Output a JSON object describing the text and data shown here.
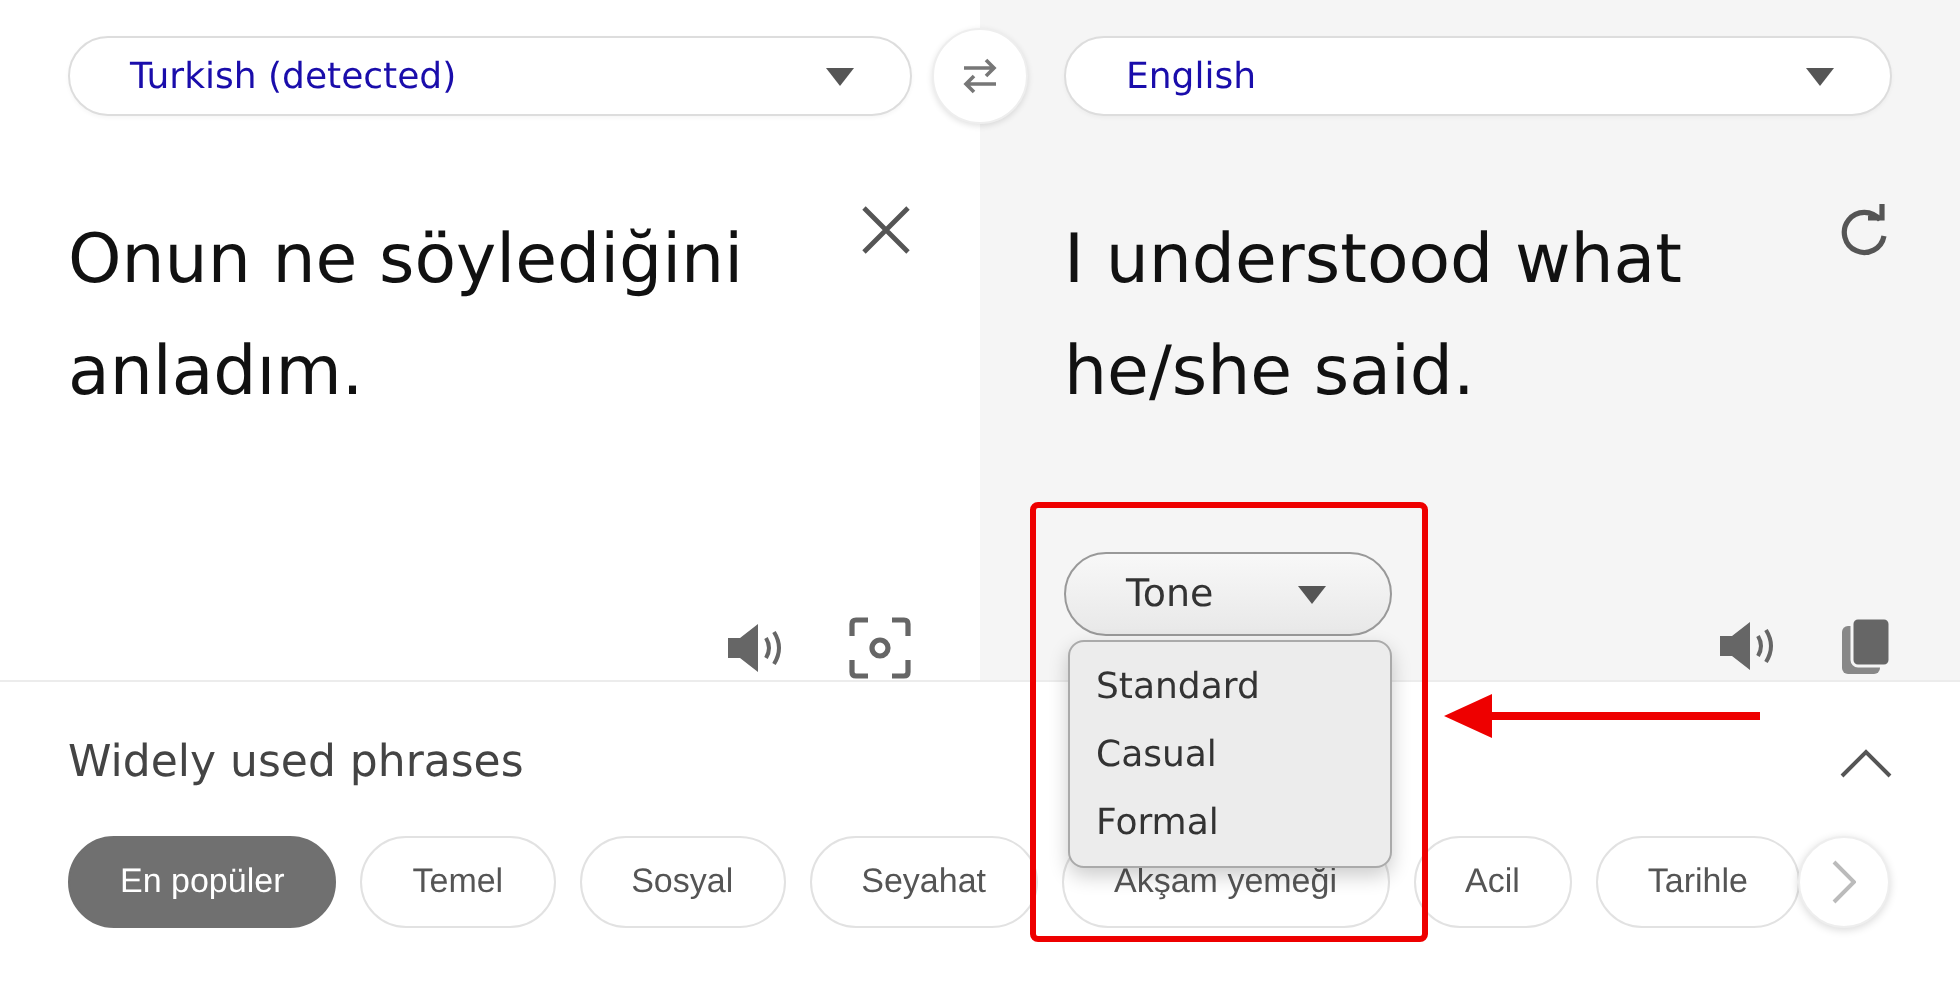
{
  "source": {
    "language": "Turkish (detected)",
    "text": "Onun ne söylediğini anladım."
  },
  "target": {
    "language": "English",
    "text": "I understood what he/she said."
  },
  "tone": {
    "label": "Tone",
    "expanded": true,
    "options": [
      "Standard",
      "Casual",
      "Formal"
    ]
  },
  "phrases": {
    "title": "Widely used phrases",
    "expanded": true,
    "categories": [
      {
        "label": "En popüler",
        "selected": true
      },
      {
        "label": "Temel",
        "selected": false
      },
      {
        "label": "Sosyal",
        "selected": false
      },
      {
        "label": "Seyahat",
        "selected": false
      },
      {
        "label": "Akşam yemeği",
        "selected": false
      },
      {
        "label": "Acil",
        "selected": false
      },
      {
        "label": "Tarihle",
        "selected": false
      }
    ]
  }
}
